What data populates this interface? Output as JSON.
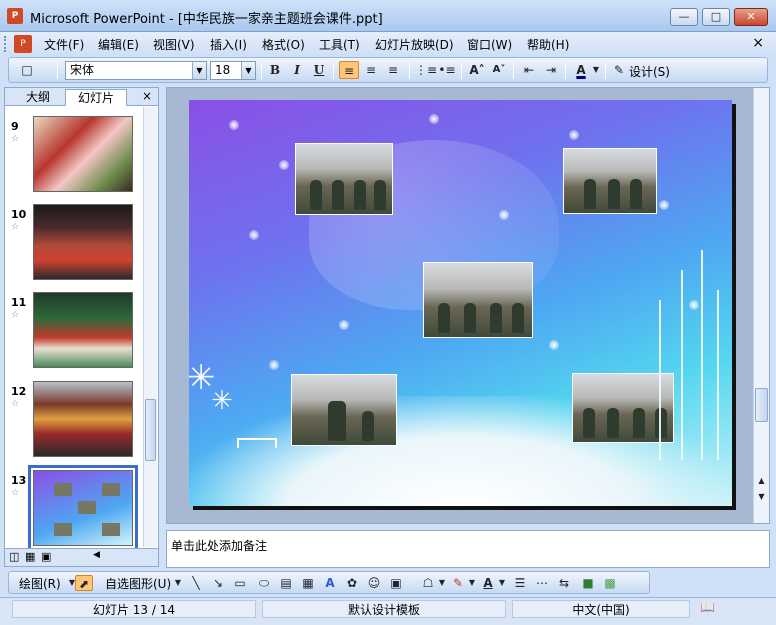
{
  "window": {
    "title": "Microsoft PowerPoint - [中华民族一家亲主题班会课件.ppt]",
    "app_icon": "powerpoint-icon",
    "controls": [
      "minimize",
      "maximize",
      "close"
    ]
  },
  "menubar": {
    "items": [
      "文件(F)",
      "编辑(E)",
      "视图(V)",
      "插入(I)",
      "格式(O)",
      "工具(T)",
      "幻灯片放映(D)",
      "窗口(W)",
      "帮助(H)"
    ],
    "close_glyph": "×"
  },
  "toolbar": {
    "font_name": "宋体",
    "font_size": "18",
    "bold": "B",
    "italic": "I",
    "underline": "U",
    "design_label": "设计(S)"
  },
  "left_pane": {
    "tab_outline": "大纲",
    "tab_slides": "幻灯片",
    "close_glyph": "×",
    "slides": [
      {
        "number": "9"
      },
      {
        "number": "10"
      },
      {
        "number": "11"
      },
      {
        "number": "12"
      },
      {
        "number": "13",
        "selected": true
      }
    ]
  },
  "notes": {
    "placeholder": "单击此处添加备注"
  },
  "drawbar": {
    "draw_label": "绘图(R)",
    "autoshapes_label": "自选图形(U)"
  },
  "statusbar": {
    "slide_info": "幻灯片 13 / 14",
    "template": "默认设计模板",
    "language": "中文(中国)"
  },
  "colors": {
    "accent_active": "#ffc775",
    "selection": "#3a6ec8",
    "chrome": "#cfe0f7"
  }
}
